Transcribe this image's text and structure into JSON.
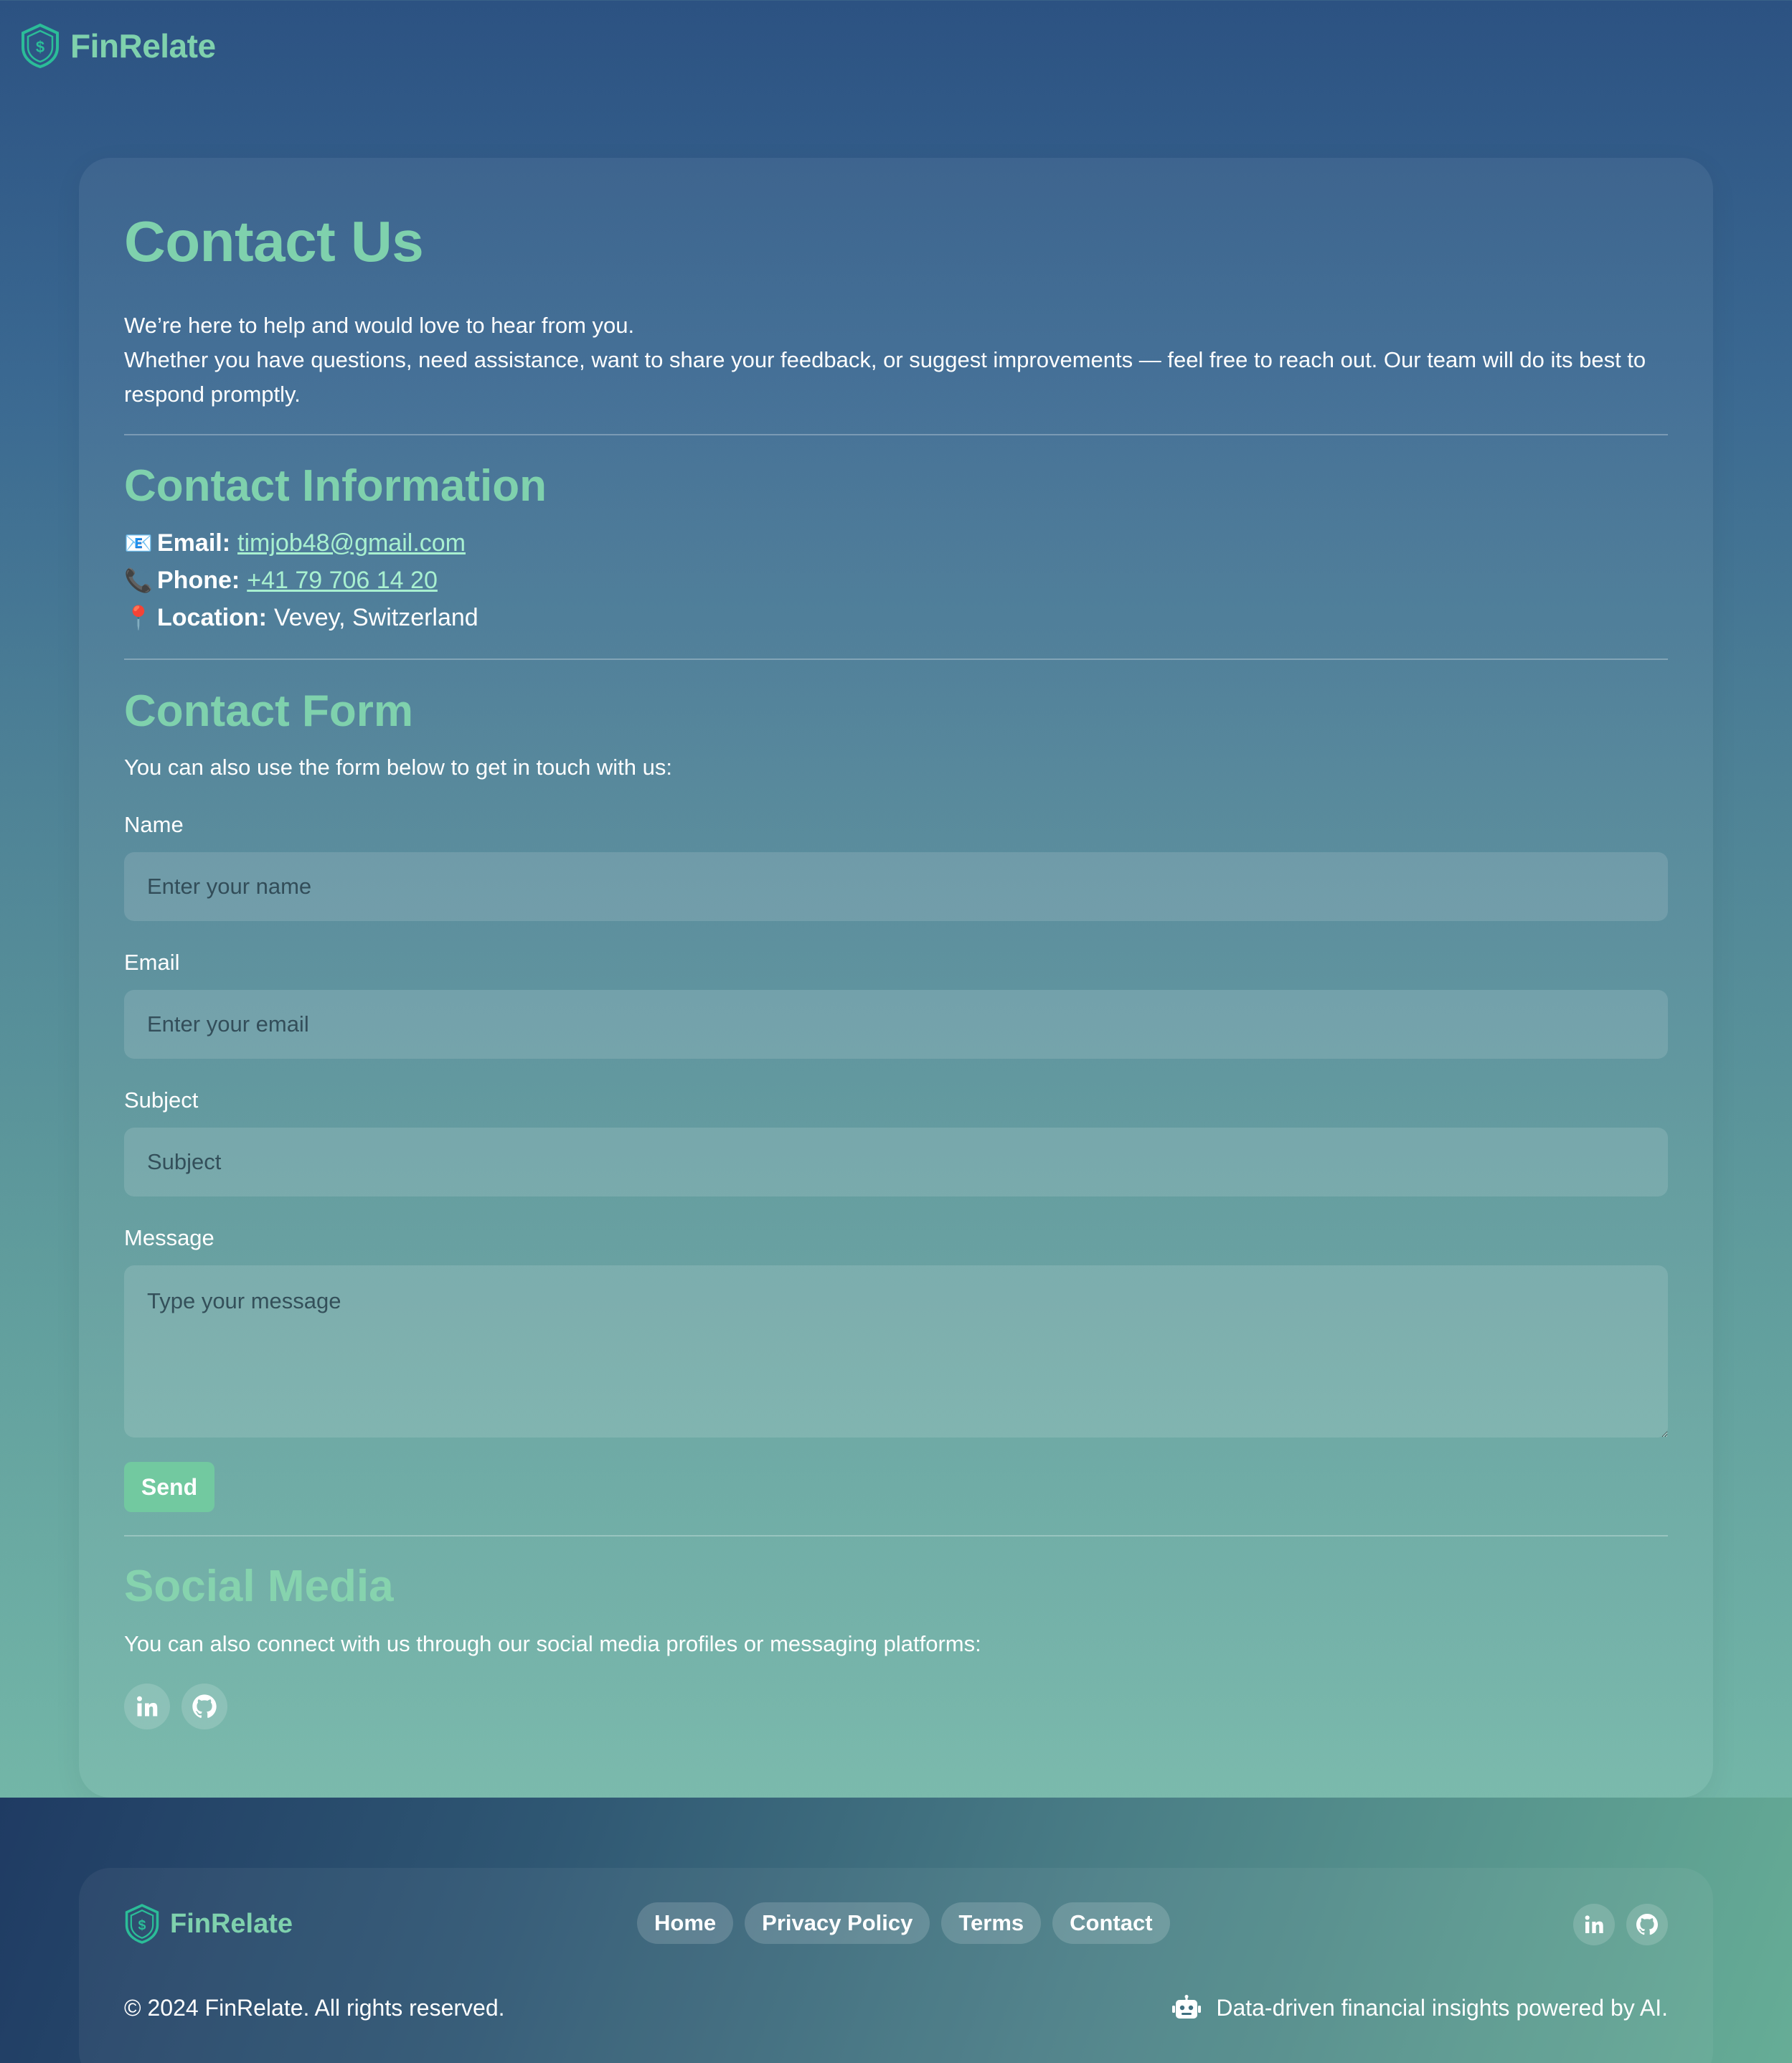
{
  "header": {
    "brand_name": "FinRelate"
  },
  "main": {
    "title": "Contact Us",
    "intro_line1": "We’re here to help and would love to hear from you.",
    "intro_line2": "Whether you have questions, need assistance, want to share your feedback, or suggest improvements — feel free to reach out. Our team will do its best to respond promptly.",
    "contact_info": {
      "heading": "Contact Information",
      "email_label": "Email:",
      "email_value": "timjob48@gmail.com",
      "phone_label": "Phone:",
      "phone_value": "+41 79 706 14 20",
      "location_label": "Location:",
      "location_value": "Vevey, Switzerland"
    },
    "contact_form": {
      "heading": "Contact Form",
      "description": "You can also use the form below to get in touch with us:",
      "name_label": "Name",
      "name_placeholder": "Enter your name",
      "email_label": "Email",
      "email_placeholder": "Enter your email",
      "subject_label": "Subject",
      "subject_placeholder": "Subject",
      "message_label": "Message",
      "message_placeholder": "Type your message",
      "send_label": "Send"
    },
    "social": {
      "heading": "Social Media",
      "description": "You can also connect with us through our social media profiles or messaging platforms:",
      "icons": [
        "linkedin-icon",
        "github-icon"
      ]
    }
  },
  "footer": {
    "brand_name": "FinRelate",
    "nav": [
      "Home",
      "Privacy Policy",
      "Terms",
      "Contact"
    ],
    "copyright": "© 2024 FinRelate. All rights reserved.",
    "tagline": "Data-driven financial insights powered by AI.",
    "social_icons": [
      "linkedin-icon",
      "github-icon"
    ]
  },
  "colors": {
    "accent": "#7fd1ad",
    "button": "#72c9a0",
    "link": "#a8f0d0",
    "bg_top": "#2c5282",
    "bg_bottom": "#7abca8"
  }
}
